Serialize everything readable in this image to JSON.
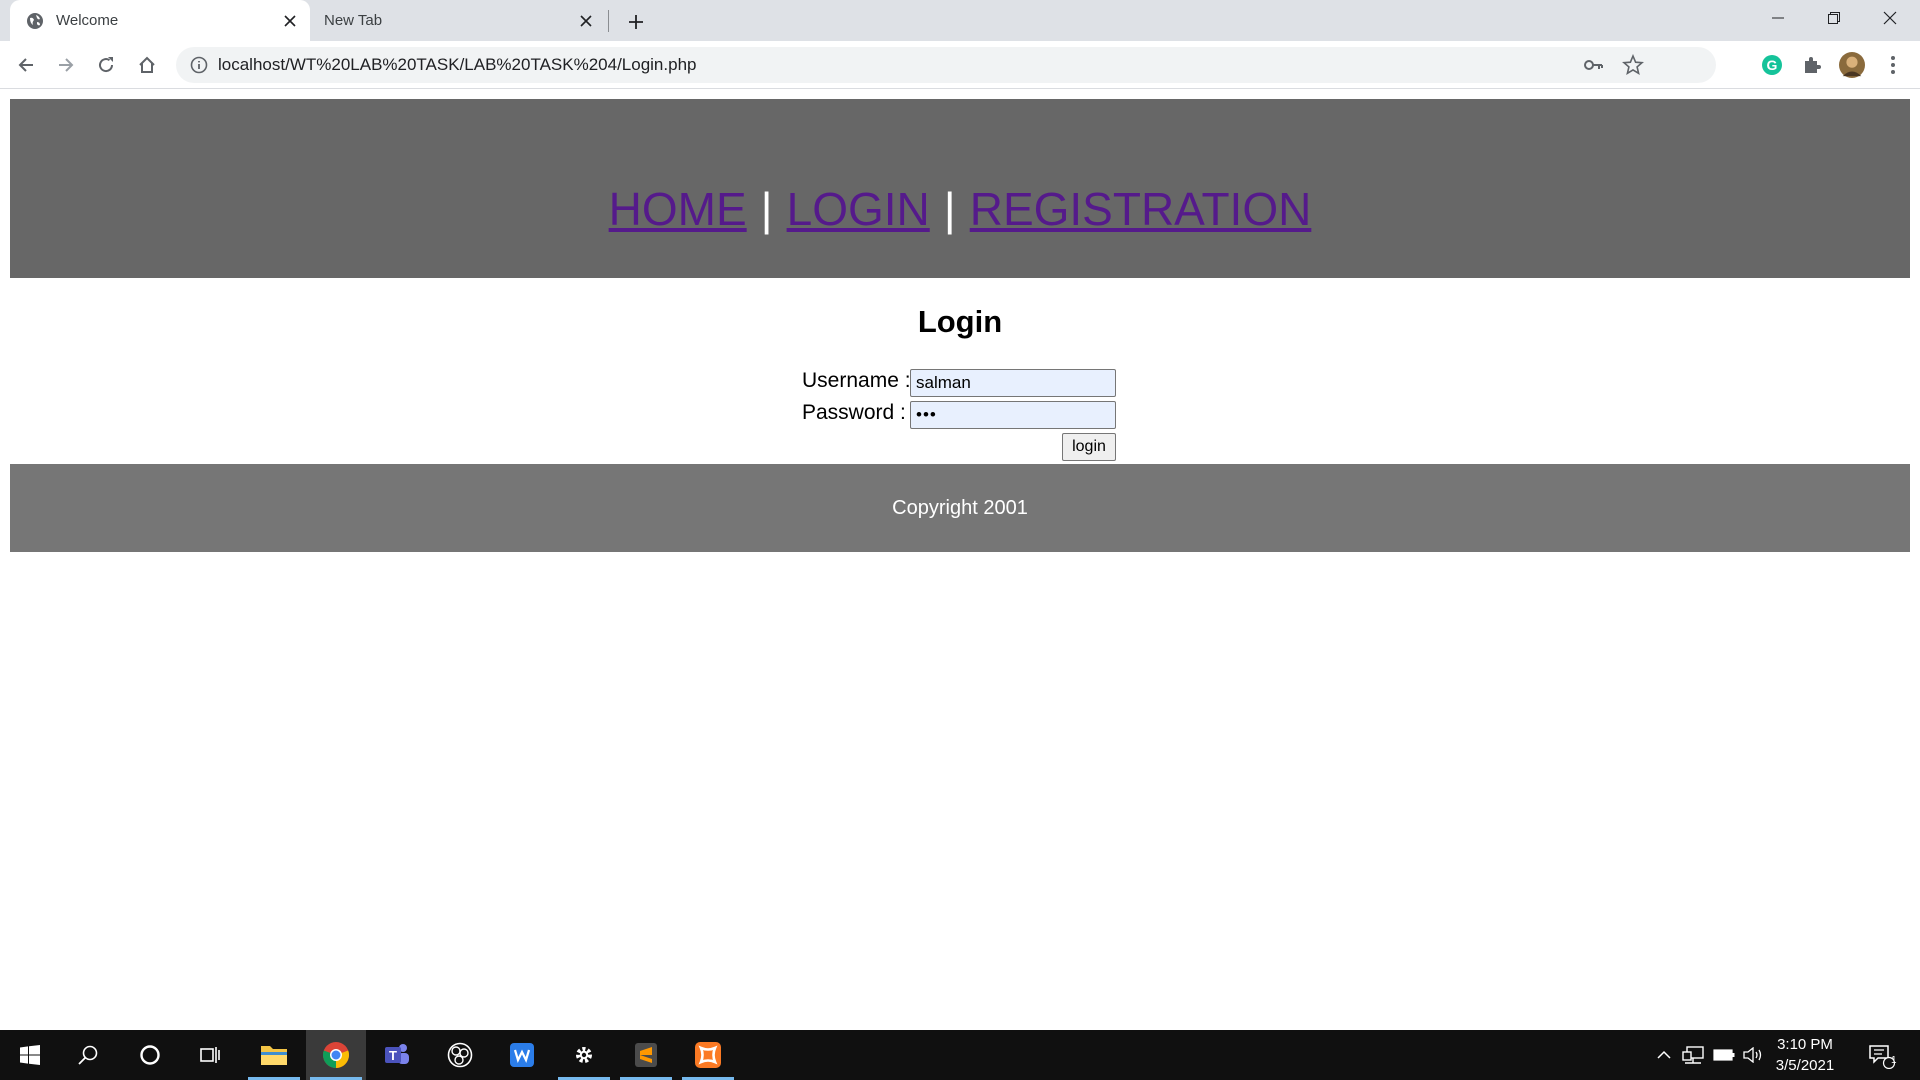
{
  "browser": {
    "tabs": [
      {
        "title": "Welcome",
        "active": true
      },
      {
        "title": "New Tab",
        "active": false
      }
    ],
    "url": "localhost/WT%20LAB%20TASK/LAB%20TASK%204/Login.php"
  },
  "page": {
    "nav": {
      "home": "HOME",
      "login": "LOGIN",
      "registration": "REGISTRATION",
      "separator": "|"
    },
    "title": "Login",
    "form": {
      "username_label": "Username :",
      "username_value": "salman",
      "password_label": "Password :",
      "password_value": "•••",
      "submit_label": "login"
    },
    "footer": "Copyright 2001"
  },
  "taskbar": {
    "time": "3:10 PM",
    "date": "3/5/2021",
    "notification_count": "1"
  },
  "colors": {
    "header_bg": "#676767",
    "footer_bg": "#767676",
    "link_visited": "#551a8b",
    "autofill_bg": "#e8f0fe"
  }
}
